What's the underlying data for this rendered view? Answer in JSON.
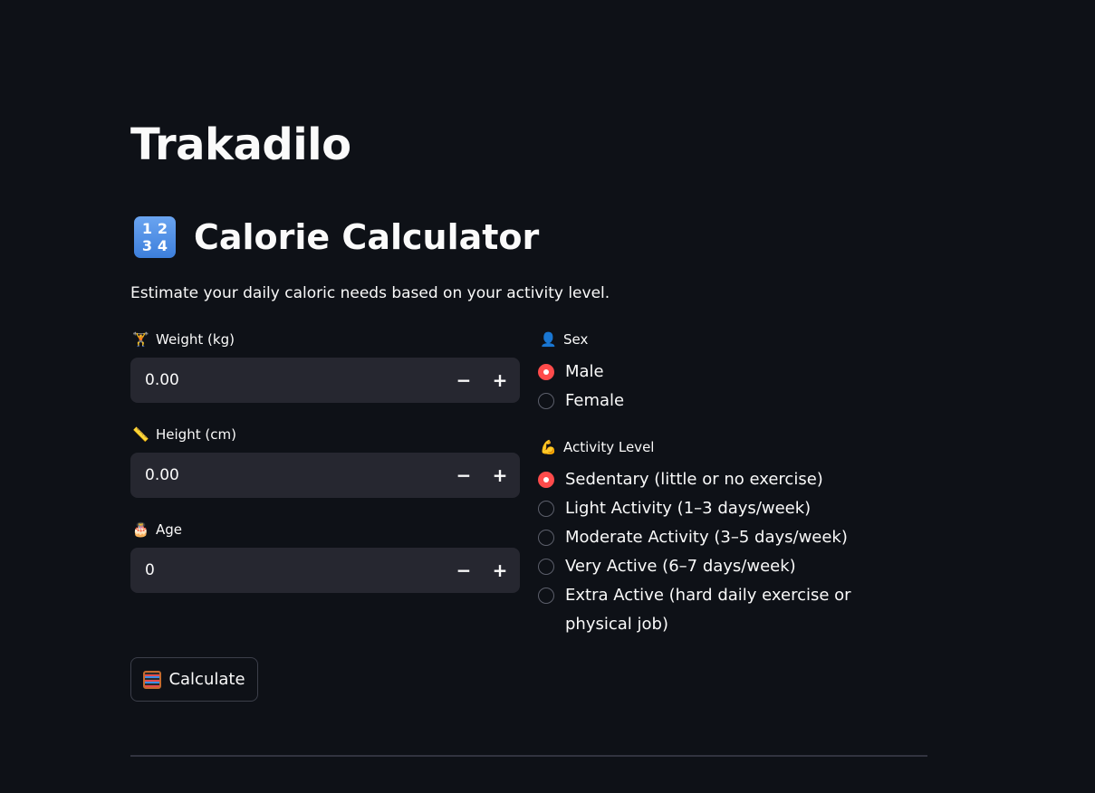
{
  "app": {
    "title": "Trakadilo"
  },
  "section": {
    "icon": "keycap-1234-icon",
    "icon_digits": [
      "1",
      "2",
      "3",
      "4"
    ],
    "title": "Calorie Calculator",
    "description": "Estimate your daily caloric needs based on your activity level."
  },
  "inputs": {
    "weight": {
      "icon": "🏋",
      "label": "Weight (kg)",
      "value": "0.00"
    },
    "height": {
      "icon": "📏",
      "label": "Height (cm)",
      "value": "0.00"
    },
    "age": {
      "icon": "🎂",
      "label": "Age",
      "value": "0"
    },
    "decrement_symbol": "−",
    "increment_symbol": "+"
  },
  "sex": {
    "icon": "👤",
    "label": "Sex",
    "options": [
      "Male",
      "Female"
    ],
    "selected": "Male"
  },
  "activity": {
    "icon": "💪",
    "label": "Activity Level",
    "options": [
      "Sedentary (little or no exercise)",
      "Light Activity (1–3 days/week)",
      "Moderate Activity (3–5 days/week)",
      "Very Active (6–7 days/week)",
      "Extra Active (hard daily exercise or physical job)"
    ],
    "selected": "Sedentary (little or no exercise)"
  },
  "actions": {
    "calculate_icon": "abacus-icon",
    "calculate_label": "Calculate"
  },
  "colors": {
    "background": "#0e1117",
    "input_bg": "#262730",
    "accent": "#ff4b4b",
    "text": "#fafafa"
  }
}
